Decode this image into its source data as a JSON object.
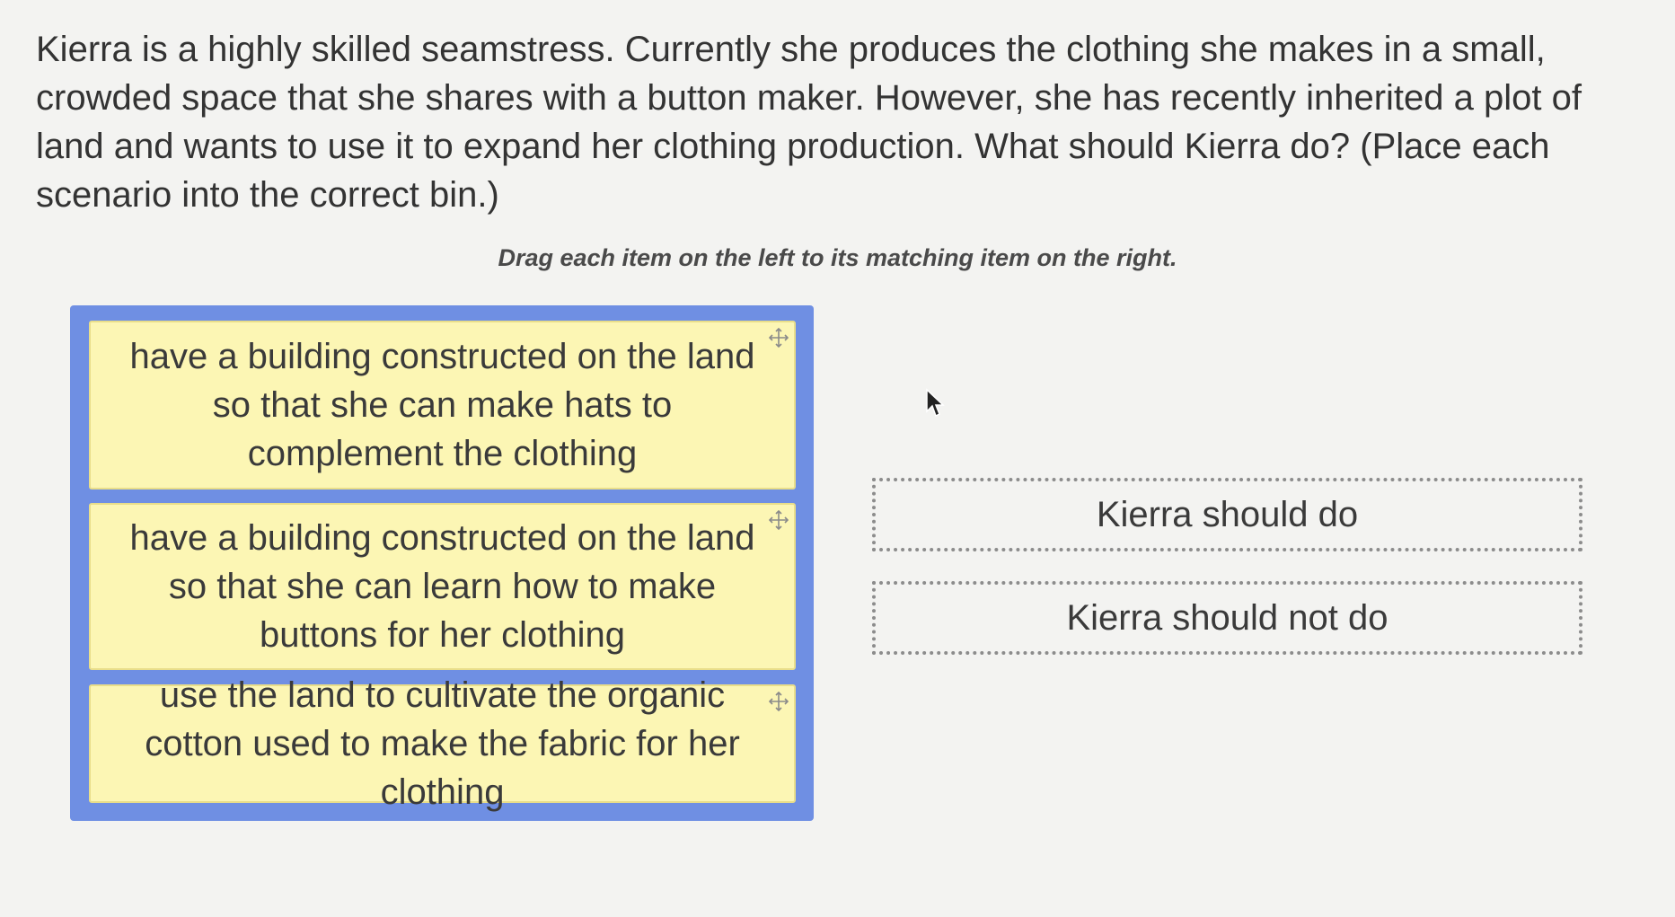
{
  "question": "Kierra is a highly skilled seamstress. Currently she produces the clothing she makes in a small, crowded space that she shares with a button maker. However, she has recently inherited a plot of land and wants to use it to expand her clothing production. What should Kierra do? (Place each scenario into the correct bin.)",
  "instruction": "Drag each item on the left to its matching item on the right.",
  "items": [
    {
      "label": "have a building constructed on the land so that she can make hats to complement the clothing",
      "icon": "move-icon"
    },
    {
      "label": "have a building constructed on the land so that she can learn how to make buttons for her clothing",
      "icon": "move-icon"
    },
    {
      "label": "use the land to cultivate the organic cotton used to make the fabric for her clothing",
      "icon": "move-icon"
    }
  ],
  "bins": [
    {
      "label": "Kierra should do"
    },
    {
      "label": "Kierra should not do"
    }
  ],
  "colors": {
    "panel": "#6f8fe3",
    "item_background": "#fcf6b4",
    "page_background": "#f3f3f1"
  }
}
